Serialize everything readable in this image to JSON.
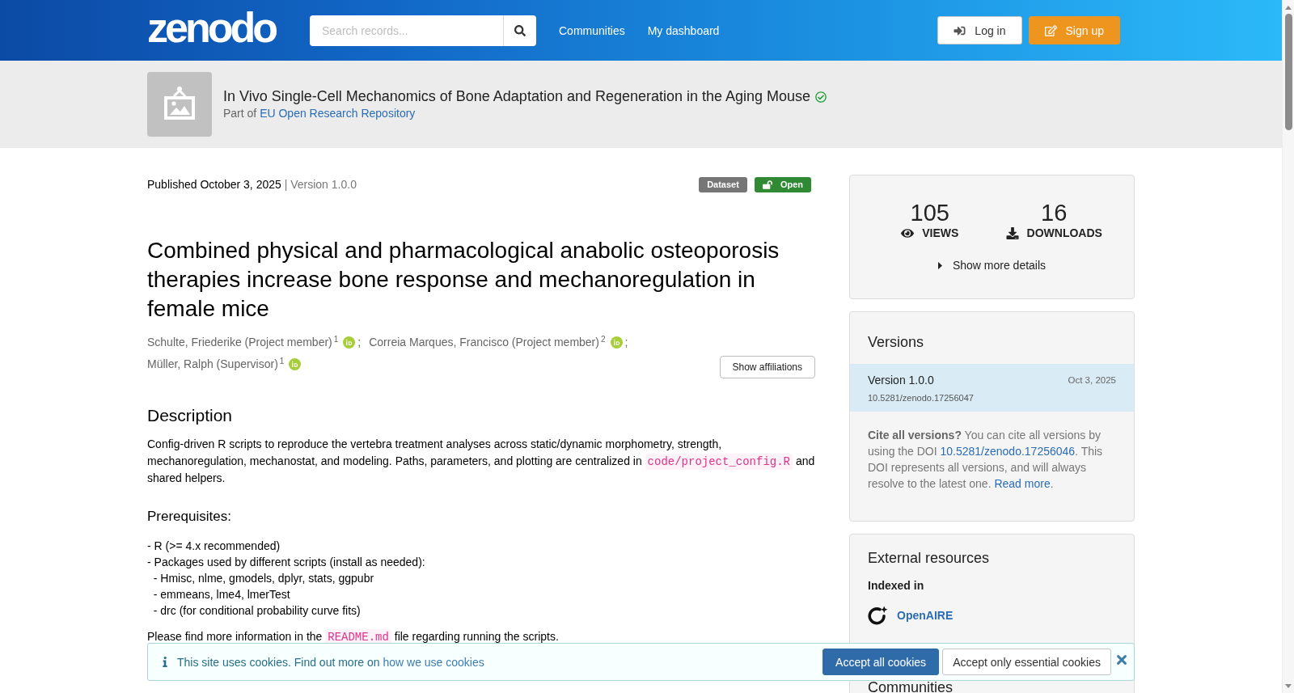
{
  "header": {
    "logo": "zenodo",
    "search": {
      "placeholder": "Search records..."
    },
    "nav": [
      {
        "label": "Communities"
      },
      {
        "label": "My dashboard"
      }
    ],
    "buttons": [
      {
        "kind": "login",
        "label": "Log in"
      },
      {
        "kind": "signup",
        "label": "Sign up"
      }
    ]
  },
  "community": {
    "title": "In Vivo Single-Cell Mechanomics of Bone Adaptation and Regeneration in the Aging Mouse",
    "verified": true,
    "part_of": "Part of",
    "link": "EU Open Research Repository"
  },
  "record": {
    "published": "Published October 3, 2025",
    "version_info": "| Version 1.0.0",
    "badges": [
      {
        "kind": "resource_type",
        "label": "Dataset"
      },
      {
        "kind": "access",
        "label": "Open"
      }
    ],
    "title": "Combined physical and pharmacological anabolic osteoporosis therapies increase bone response and mechanoregulation in female mice",
    "creators": [
      {
        "name": "Schulte, Friederike (Project member)$^{1}$",
        "orcid": true,
        "separator": ";"
      },
      {
        "name": "Correia Marques, Francisco (Project member)$^{2}$",
        "orcid": true,
        "separator": ";"
      },
      {
        "name": "Müller, Ralph (Supervisor)$^{1}$",
        "orcid": true
      }
    ],
    "affiliations_button": "Show affiliations",
    "description": {
      "heading": "Description",
      "paragraph": [
        {
          "kind": "text",
          "text": "Config-driven R scripts to reproduce the vertebra treatment analyses across static/dynamic morphometry, strength, mechanoregulation, mechanostat, and modeling. Paths, parameters, and plotting are centralized in"
        },
        {
          "kind": "code",
          "text": "code/project_config.R"
        },
        {
          "kind": "text",
          "text": "and shared helpers."
        }
      ],
      "subheading": "Prerequisites:",
      "lines": [
        "- R (>= 4.x recommended)",
        "- Packages used by different scripts (install as needed):",
        "  - Hmisc, nlme, gmodels, dplyr, stats, ggpubr",
        "  - emmeans, lme4, lmerTest",
        "  - drc (for conditional probability curve fits)"
      ],
      "note": [
        {
          "kind": "text",
          "text": "Please find more information in the"
        },
        {
          "kind": "code",
          "text": "README.md"
        },
        {
          "kind": "text",
          "text": "file regarding running the scripts."
        }
      ]
    }
  },
  "stats": {
    "items": [
      {
        "kind": "views",
        "value": "105",
        "label": "VIEWS"
      },
      {
        "kind": "downloads",
        "value": "16",
        "label": "DOWNLOADS"
      }
    ],
    "details_toggle": {
      "label": "Show more details",
      "expanded": false
    }
  },
  "versions": {
    "title": "Versions",
    "items": [
      {
        "label": "Version 1.0.0",
        "date": "Oct 3, 2025",
        "doi": "10.5281/zenodo.17256047",
        "selected": true
      }
    ],
    "cite": [
      {
        "kind": "bold",
        "text": "Cite all versions?"
      },
      {
        "kind": "text",
        "text": " You can cite all versions by using the DOI "
      },
      {
        "kind": "link",
        "text": "10.5281/zenodo.17256046"
      },
      {
        "kind": "text",
        "text": ". This DOI represents all versions, and will always resolve to the latest one. "
      },
      {
        "kind": "link",
        "text": "Read more"
      },
      {
        "kind": "text",
        "text": "."
      }
    ]
  },
  "external_resources": {
    "title": "External resources",
    "subtitle": "Indexed in",
    "items": [
      {
        "name": "OpenAIRE"
      }
    ]
  },
  "communities": {
    "title": "Communities"
  },
  "cookie_banner": {
    "message": "This site uses cookies. Find out more on",
    "link": "how we use cookies",
    "buttons": [
      {
        "kind": "primary",
        "label": "Accept all cookies"
      },
      {
        "kind": "secondary",
        "label": "Accept only essential cookies"
      }
    ]
  }
}
